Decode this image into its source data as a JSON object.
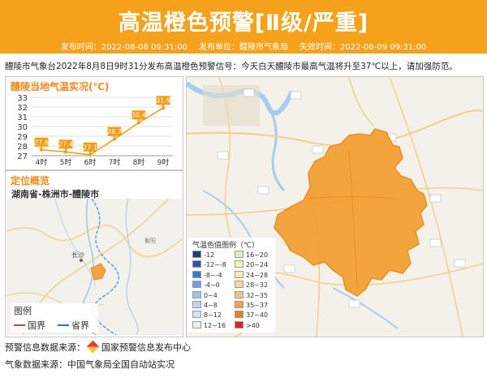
{
  "header": {
    "title": "高温橙色预警[Ⅱ级/严重]",
    "issue_time_label": "发布时间：2022-08-08 09:31:00",
    "issuer_label": "发布单位：醴陵市气象局",
    "expire_label": "失效时间：2022-08-09 09:31:00"
  },
  "summary": "醴陵市气象台2022年8月8日9时31分发布高温橙色预警信号：今天白天醴陵市最高气温将升至37℃以上，请加强防范。",
  "temp_panel": {
    "title": "醴陵当地气温实况(℃)",
    "y_ticks": [
      "33",
      "32",
      "31",
      "30",
      "29",
      "28",
      "27"
    ]
  },
  "chart_data": {
    "type": "line",
    "title": "醴陵当地气温实况(℃)",
    "categories": [
      "4时",
      "5时",
      "6时",
      "7时",
      "8时",
      "9时"
    ],
    "values": [
      27.6,
      27.4,
      27.1,
      28.7,
      30.4,
      31.9
    ],
    "ylim": [
      27,
      33
    ],
    "color": "#f39c12"
  },
  "location": {
    "title": "定位概览",
    "area": "湖南省-株洲市-醴陵市",
    "legend_title": "图例",
    "legend_items": [
      "国界",
      "省界"
    ],
    "city_label": "长沙",
    "region_label": "衡阳"
  },
  "map": {
    "legend_title": "气温色值图例（℃）",
    "legend_items": [
      {
        "label": "-12",
        "color": "#1a3a8a"
      },
      {
        "label": "16~20",
        "color": "#d8f0c8"
      },
      {
        "label": "-12~-8",
        "color": "#2556b0"
      },
      {
        "label": "20~24",
        "color": "#f3f6b2"
      },
      {
        "label": "-8~-4",
        "color": "#3d78d0"
      },
      {
        "label": "24~28",
        "color": "#fbeea0"
      },
      {
        "label": "-4~0",
        "color": "#6d9fe2"
      },
      {
        "label": "28~32",
        "color": "#fad79a"
      },
      {
        "label": "0~4",
        "color": "#9ec4ee"
      },
      {
        "label": "32~35",
        "color": "#f9c187"
      },
      {
        "label": "4~8",
        "color": "#bad8f4"
      },
      {
        "label": "35~37",
        "color": "#f6a04a"
      },
      {
        "label": "8~12",
        "color": "#cde6f2"
      },
      {
        "label": "37~40",
        "color": "#f47a1c"
      },
      {
        "label": "12~16",
        "color": "#e6f4ea"
      },
      {
        "label": ">40",
        "color": "#e02020"
      }
    ]
  },
  "footer": {
    "warning_source_label": "预警信息数据来源：",
    "warning_source": "国家预警信息发布中心",
    "weather_source": "气象数据来源：中国气象局全国自动站实况"
  }
}
